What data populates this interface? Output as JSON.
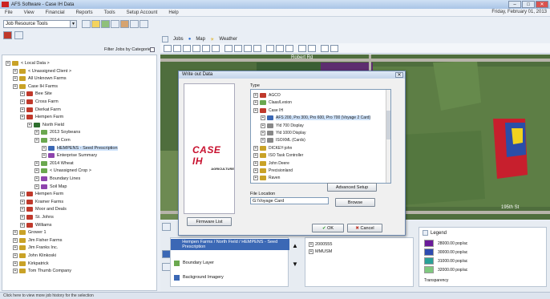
{
  "window": {
    "title": "AFS Software - Case IH Data",
    "datetime": "Friday, February 01, 2013"
  },
  "menu": [
    "File",
    "View",
    "Financial",
    "Reports",
    "Tools",
    "Setup Account",
    "Help"
  ],
  "left_toolbar": {
    "resource_combo": "Job Resource Tools",
    "filter_label": "Filter Jobs by Categories"
  },
  "tree": [
    {
      "label": "< Local Data >",
      "depth": 0,
      "color": "#c9a227"
    },
    {
      "label": "< Unassigned Client >",
      "depth": 1,
      "color": "#c9a227"
    },
    {
      "label": "All Unknown Farms",
      "depth": 1,
      "color": "#c9a227"
    },
    {
      "label": "Case IH Farms",
      "depth": 1,
      "color": "#c9a227"
    },
    {
      "label": "Bee Site",
      "depth": 2,
      "color": "#c0392b"
    },
    {
      "label": "Cross Farm",
      "depth": 2,
      "color": "#c0392b"
    },
    {
      "label": "Dierkat Farm",
      "depth": 2,
      "color": "#c0392b"
    },
    {
      "label": "Hempen Farm",
      "depth": 2,
      "color": "#c0392b"
    },
    {
      "label": "North Field",
      "depth": 3,
      "color": "#2e6f2e"
    },
    {
      "label": "2013 Soybeans",
      "depth": 4,
      "color": "#6aa84f"
    },
    {
      "label": "2014 Corn",
      "depth": 4,
      "color": "#6aa84f"
    },
    {
      "label": "HEMPENS - Seed Prescription",
      "depth": 5,
      "color": "#3b68b5",
      "selected": true
    },
    {
      "label": "Enterprise Summary",
      "depth": 5,
      "color": "#8e44ad"
    },
    {
      "label": "2014 Wheat",
      "depth": 4,
      "color": "#6aa84f"
    },
    {
      "label": "< Unassigned Crop >",
      "depth": 4,
      "color": "#6aa84f"
    },
    {
      "label": "Boundary Lines",
      "depth": 4,
      "color": "#8e44ad"
    },
    {
      "label": "Soil Map",
      "depth": 4,
      "color": "#8e44ad"
    },
    {
      "label": "Hempen Farm",
      "depth": 2,
      "color": "#c0392b"
    },
    {
      "label": "Kramer Farms",
      "depth": 2,
      "color": "#c0392b"
    },
    {
      "label": "Moor and Deals",
      "depth": 2,
      "color": "#c0392b"
    },
    {
      "label": "St. Johns",
      "depth": 2,
      "color": "#c0392b"
    },
    {
      "label": "Williams",
      "depth": 2,
      "color": "#c0392b"
    },
    {
      "label": "Grower 1",
      "depth": 1,
      "color": "#c9a227"
    },
    {
      "label": "Jim Fisher Farms",
      "depth": 1,
      "color": "#c9a227"
    },
    {
      "label": "Jim Franks Inc.",
      "depth": 1,
      "color": "#c9a227"
    },
    {
      "label": "John Klinkoski",
      "depth": 1,
      "color": "#c9a227"
    },
    {
      "label": "Kirkpatrick",
      "depth": 1,
      "color": "#c9a227"
    },
    {
      "label": "Tom Thumb Company",
      "depth": 1,
      "color": "#c9a227"
    }
  ],
  "view_tabs": [
    "Jobs",
    "Map",
    "Weather"
  ],
  "map": {
    "road_top": "Robert Rd",
    "road_bottom": "195th St"
  },
  "dialog": {
    "title": "Write out Data",
    "brand": "CASE IH",
    "brand_sub": "AGRICULTURE",
    "type_label": "Type",
    "type_tree": [
      {
        "label": "AGCO",
        "depth": 0,
        "color": "#c0392b"
      },
      {
        "label": "Claas/Lexion",
        "depth": 0,
        "color": "#6aa84f"
      },
      {
        "label": "Case IH",
        "depth": 0,
        "color": "#c0392b"
      },
      {
        "label": "AFS 200, Pro 300, Pro 600, Pro 700 (Voyage 2 Card)",
        "depth": 1,
        "color": "#3b68b5",
        "selected": true
      },
      {
        "label": "Yld 700 Display",
        "depth": 1,
        "color": "#888"
      },
      {
        "label": "Yld 1000 Display",
        "depth": 1,
        "color": "#888"
      },
      {
        "label": "ISOXML (Cards)",
        "depth": 1,
        "color": "#888"
      },
      {
        "label": "DICKEY-john",
        "depth": 0,
        "color": "#c9a227"
      },
      {
        "label": "ISO Task Controller",
        "depth": 0,
        "color": "#c9a227"
      },
      {
        "label": "John Deere",
        "depth": 0,
        "color": "#c9a227"
      },
      {
        "label": "Precisionland",
        "depth": 0,
        "color": "#c9a227"
      },
      {
        "label": "Raven",
        "depth": 0,
        "color": "#c9a227"
      }
    ],
    "advanced_button": "Advanced Setup",
    "file_location_label": "File Location",
    "file_location_value": "G:\\Voyage Card",
    "browse_button": "Browse",
    "firmware_button": "Firmware List",
    "ok_button": "OK",
    "cancel_button": "Cancel"
  },
  "layers": [
    {
      "label": "Hempen Farms / North Field / HEMPENS - Seed Prescription",
      "color": "#3b68b5",
      "selected": true
    },
    {
      "label": "Boundary Layer",
      "color": "#6aa84f"
    },
    {
      "label": "Background Imagery",
      "color": "#3b68b5"
    }
  ],
  "mid_panel": [
    "2000555",
    "MMUSM"
  ],
  "legend": {
    "title": "Legend",
    "items": [
      {
        "label": "28000.00 pop/ac",
        "color": "#6a1b9a"
      },
      {
        "label": "30000.00 pop/ac",
        "color": "#2e4bb0"
      },
      {
        "label": "31000.00 pop/ac",
        "color": "#2aa198"
      },
      {
        "label": "32000.00 pop/ac",
        "color": "#7fc97f"
      }
    ],
    "footer": "Transparency"
  },
  "status": "Click here to view more job history for the selection"
}
